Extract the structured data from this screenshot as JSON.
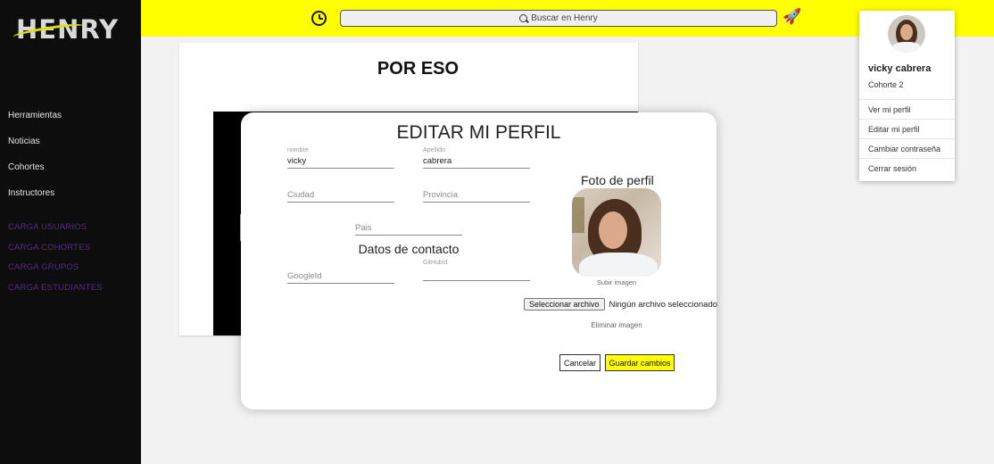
{
  "sidebar": {
    "logo_text": "HENRY",
    "nav_items": [
      "Herramientas",
      "Noticias",
      "Cohortes",
      "Instructores"
    ],
    "admin_items": [
      "CARGA USUARIOS",
      "CARGA COHORTES",
      "CARGA GRUPOS",
      "CARGA ESTUDIANTES"
    ]
  },
  "topbar": {
    "search_placeholder": "Buscar en Henry",
    "accent_color": "#ffff00"
  },
  "content": {
    "title": "POR ESO"
  },
  "modal": {
    "title": "EDITAR MI PERFIL",
    "fields": {
      "nombre": {
        "label": "nombre",
        "value": "vicky"
      },
      "apellido": {
        "label": "Apellido",
        "value": "cabrera"
      },
      "ciudad": {
        "placeholder": "Ciudad"
      },
      "provincia": {
        "placeholder": "Provincia"
      },
      "pais": {
        "placeholder": "Pais"
      },
      "googleid": {
        "placeholder": "GoogleId"
      },
      "githubid": {
        "label": "GitHubId",
        "value": ""
      }
    },
    "contact_section_title": "Datos de contacto",
    "photo_title": "Foto de perfil",
    "upload_label": "Subir imagen",
    "file_button": "Seleccionar archivo",
    "file_status": "Ningún archivo seleccionado",
    "remove_image": "Eliminar imagen",
    "cancel_label": "Cancelar",
    "save_label": "Guardar cambios"
  },
  "user_menu": {
    "name": "vicky cabrera",
    "cohort": "Cohorte 2",
    "items": [
      "Ver mi perfil",
      "Editar mi perfil",
      "Cambiar contraseña",
      "Cerrar sesión"
    ]
  }
}
